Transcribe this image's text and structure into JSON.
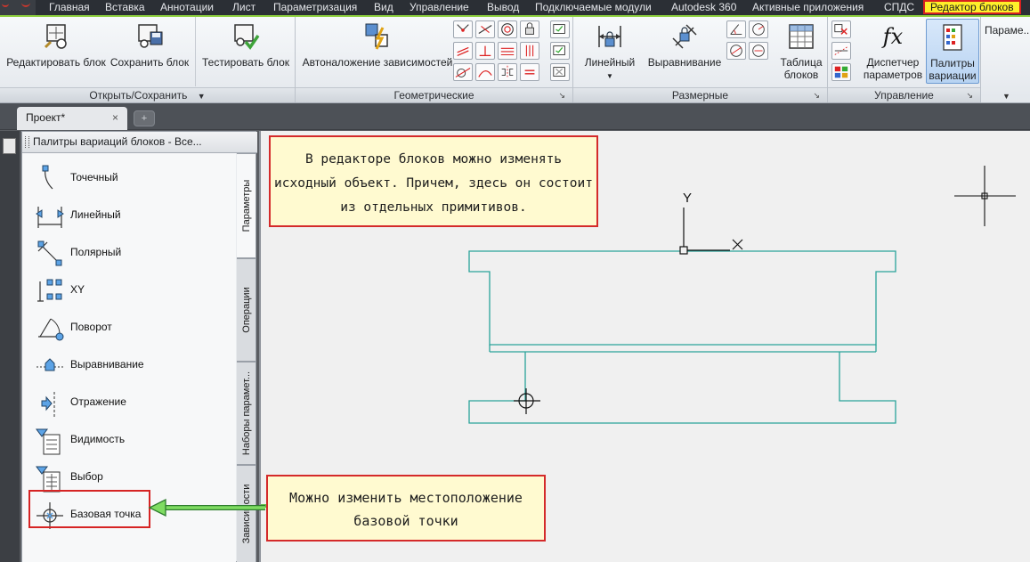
{
  "menu": {
    "tabs": [
      "Главная",
      "Вставка",
      "Аннотации",
      "Лист",
      "Параметризация",
      "Вид",
      "Управление",
      "Вывод",
      "Подключаемые модули",
      "Autodesk 360",
      "Активные приложения",
      "СПДС",
      "Редактор блоков"
    ],
    "active": "Редактор блоков"
  },
  "ribbon": {
    "open_save": {
      "title": "Открыть/Сохранить",
      "edit_block": "Редактировать блок",
      "save_block": "Сохранить блок"
    },
    "test": {
      "test_block": "Тестировать блок"
    },
    "geometric": {
      "title": "Геометрические",
      "auto_constrain": "Автоналожение зависимостей"
    },
    "dimensional": {
      "title": "Размерные",
      "linear": "Линейный",
      "aligned": "Выравнивание",
      "block_table": "Таблица блоков"
    },
    "manage": {
      "title": "Управление",
      "param_manager": "Диспетчер параметров",
      "variation_palettes": "Палитры вариации"
    },
    "more": {
      "label": "Параме..."
    }
  },
  "document": {
    "tab": "Проект*",
    "close": "×",
    "new_tab": "+"
  },
  "palette": {
    "title": "Палитры вариаций блоков - Все...",
    "items": [
      "Точечный",
      "Линейный",
      "Полярный",
      "XY",
      "Поворот",
      "Выравнивание",
      "Отражение",
      "Видимость",
      "Выбор",
      "Базовая точка"
    ],
    "side_tabs": [
      "Параметры",
      "Операции",
      "Наборы парамет...",
      "Зависимости"
    ]
  },
  "canvas": {
    "axis_label": "Y",
    "note_top": "В редакторе блоков можно изменять исходный объект. Причем, здесь он состоит из отдельных примитивов.",
    "note_bottom": "Можно изменить местоположение базовой точки"
  },
  "colors": {
    "accent_green": "#62c04a",
    "drawing_cyan": "#2aa39a",
    "annotation_red": "#d62424",
    "note_bg": "#fffad0",
    "active_tab_yellow": "#ffef2a"
  }
}
